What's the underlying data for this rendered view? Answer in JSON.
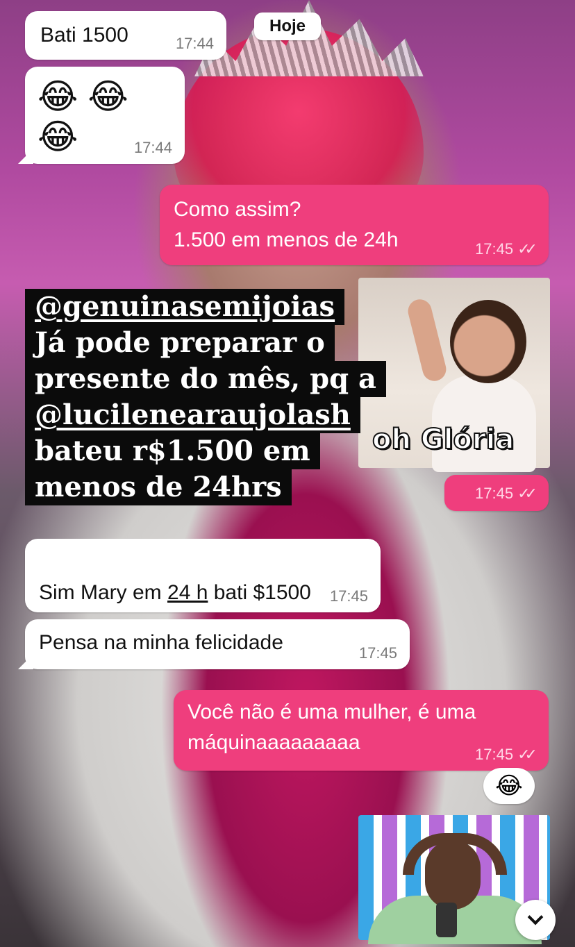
{
  "day_separator": "Hoje",
  "messages": [
    {
      "id": "m1",
      "dir": "in",
      "text": "Bati 1500",
      "time": "17:44"
    },
    {
      "id": "m2",
      "dir": "in",
      "text": "😂😂😂",
      "time": "17:44"
    },
    {
      "id": "m3",
      "dir": "out",
      "text": "Como assim?\n1.500 em menos de 24h",
      "time": "17:45",
      "status_icon": "double-check-icon"
    },
    {
      "id": "m4",
      "dir": "out",
      "type": "sticker",
      "caption": "oh Glória",
      "time": "17:45",
      "status_icon": "double-check-icon"
    },
    {
      "id": "m5",
      "dir": "in",
      "text_parts": [
        "Sim Mary em ",
        "24 h",
        " bati $1500"
      ],
      "time": "17:45"
    },
    {
      "id": "m6",
      "dir": "in",
      "text": "Pensa na minha felicidade",
      "time": "17:45"
    },
    {
      "id": "m7",
      "dir": "out",
      "text": "Você não é uma mulher, é uma\nmáquinaaaaaaaaa",
      "time": "17:45",
      "status_icon": "double-check-icon",
      "reaction": "😂"
    },
    {
      "id": "m8",
      "dir": "out",
      "type": "sticker",
      "caption": ""
    }
  ],
  "story_overlay": {
    "lines": [
      "@genuinasemijoias",
      "Já pode preparar o",
      "presente do mês, pq a",
      "@lucilenearaujolash",
      "bateu r$1.500 em",
      "menos de 24hrs"
    ]
  },
  "colors": {
    "outgoing_bubble": "#ef3e7d",
    "incoming_bubble": "#ffffff",
    "story_text_bg": "#0b0b0b"
  },
  "icons": {
    "scroll_down": "chevron-down-icon",
    "read_receipt": "double-check-icon"
  }
}
